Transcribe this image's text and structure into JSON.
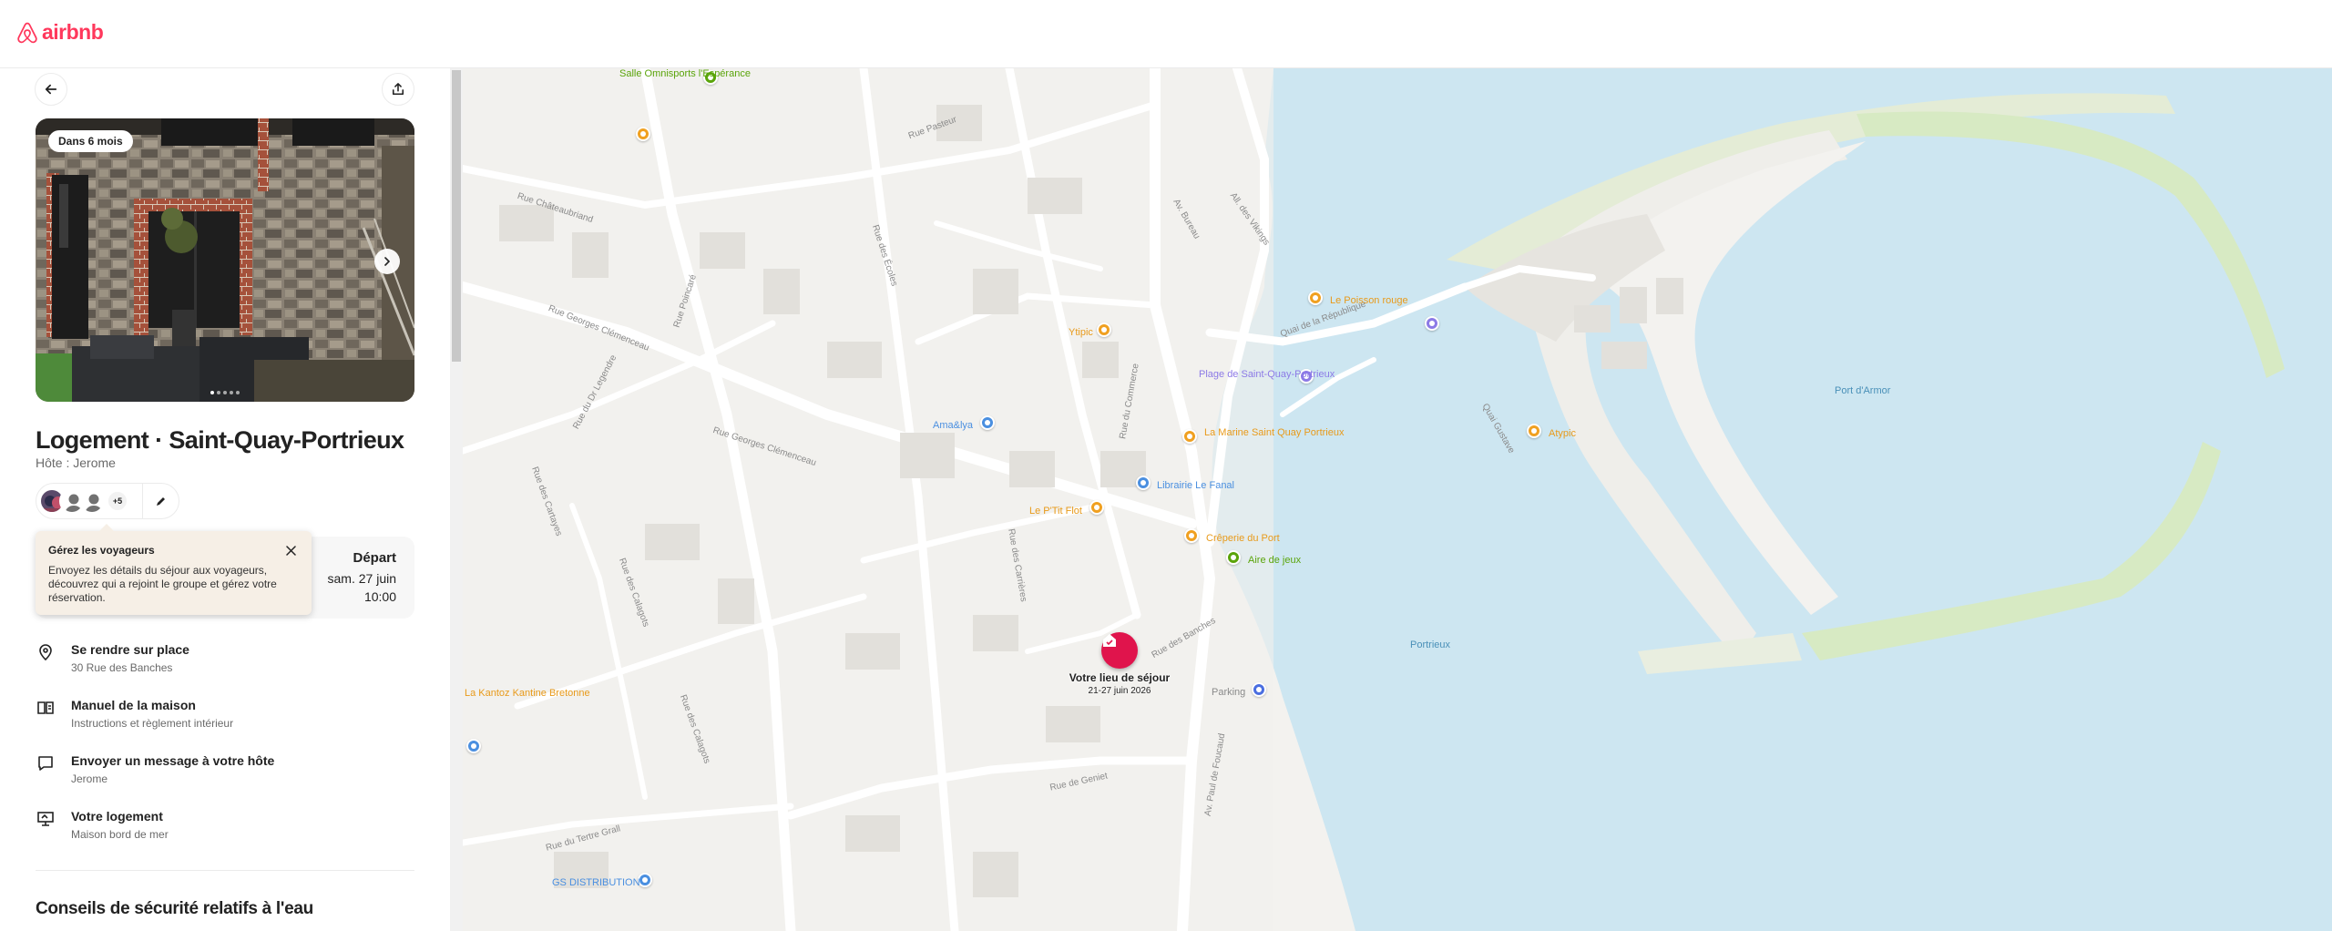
{
  "app": {
    "logo_text": "airbnb",
    "brand_color": "#FF385C"
  },
  "listing": {
    "photo_badge": "Dans 6 mois",
    "photo_count": 5,
    "photo_index": 1,
    "title": "Logement · Saint-Quay-Portrieux",
    "host": "Hôte : Jerome",
    "guests_extra": "+5"
  },
  "trip": {
    "depart_label": "Départ",
    "depart_date": "sam. 27 juin",
    "depart_time": "10:00"
  },
  "tooltip": {
    "title": "Gérez les voyageurs",
    "body": "Envoyez les détails du séjour aux voyageurs, découvrez qui a rejoint le groupe et gérez votre réservation."
  },
  "menu": [
    {
      "icon": "location-pin-icon",
      "title": "Se rendre sur place",
      "subtitle": "30 Rue des Banches"
    },
    {
      "icon": "house-manual-icon",
      "title": "Manuel de la maison",
      "subtitle": "Instructions et règlement intérieur"
    },
    {
      "icon": "message-icon",
      "title": "Envoyer un message à votre hôte",
      "subtitle": "Jerome"
    },
    {
      "icon": "listing-icon",
      "title": "Votre logement",
      "subtitle": "Maison bord de mer"
    }
  ],
  "safety_title": "Conseils de sécurité relatifs à l'eau",
  "map": {
    "stay_title": "Votre lieu de séjour",
    "stay_dates": "21-27 juin 2026",
    "water_labels": [
      "Port d'Armor",
      "Portrieux"
    ],
    "poi": [
      {
        "name": "Salle Omnisports l'Espérance",
        "category": "sport",
        "color": "#5aa40a"
      },
      {
        "name": "Le Poisson rouge",
        "category": "restaurant",
        "color": "#f0a020"
      },
      {
        "name": "Ytipic",
        "category": "restaurant",
        "color": "#f0a020"
      },
      {
        "name": "Plage de Saint-Quay-Portrieux",
        "category": "beach",
        "color": "#8c7ae6"
      },
      {
        "name": "Ama&lya",
        "category": "shop",
        "color": "#4a8fe0"
      },
      {
        "name": "La Marine Saint Quay Portrieux",
        "category": "restaurant",
        "color": "#f0a020"
      },
      {
        "name": "Librairie Le Fanal",
        "category": "shop",
        "color": "#4a8fe0"
      },
      {
        "name": "Le P'Tit Flot",
        "category": "restaurant",
        "color": "#f0a020"
      },
      {
        "name": "Crêperie du Port",
        "category": "restaurant",
        "color": "#f0a020"
      },
      {
        "name": "Aire de jeux",
        "category": "park",
        "color": "#5aa40a"
      },
      {
        "name": "Atypic",
        "category": "restaurant",
        "color": "#f0a020"
      },
      {
        "name": "La Kantoz Kantine Bretonne",
        "category": "restaurant",
        "color": "#f0a020"
      },
      {
        "name": "Parking",
        "category": "parking",
        "color": "#4a6ee0"
      },
      {
        "name": "GS DISTRIBUTION",
        "category": "shop",
        "color": "#4a8fe0"
      }
    ],
    "roads": [
      "Rue Pasteur",
      "Rue Châteaubriand",
      "Rue des Écoles",
      "Av. Bureau",
      "All. des Vikings",
      "Rue Georges Clémenceau",
      "Rue Poincaré",
      "Rue du Dr Legendre",
      "Rue Georges Clémenceau",
      "Rue du Commerce",
      "Quai de la République",
      "Rue des Cartayes",
      "Quai Gustave",
      "Rue des Carrières",
      "Rue des Calagots",
      "Rue des Banches",
      "Rue de Geniet",
      "Av. Paul de Foucaud",
      "Rue du Tertre Grall",
      "Rue des Calagots"
    ]
  }
}
